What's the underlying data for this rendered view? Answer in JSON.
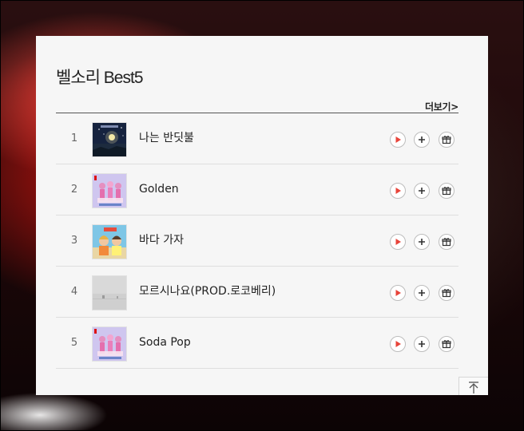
{
  "widget": {
    "title": "벨소리 Best5",
    "more_label": "더보기>"
  },
  "songs": [
    {
      "rank": "1",
      "title": "나는 반딧불",
      "art": "night-sky-firefly-art"
    },
    {
      "rank": "2",
      "title": "Golden",
      "art": "pink-anime-group-art"
    },
    {
      "rank": "3",
      "title": "바다 가자",
      "art": "beach-duo-art"
    },
    {
      "rank": "4",
      "title": "모르시나요(PROD.로코베리)",
      "art": "misty-grey-landscape-art"
    },
    {
      "rank": "5",
      "title": "Soda Pop",
      "art": "pink-anime-group-art"
    }
  ],
  "icons": {
    "play": "play-icon",
    "add": "plus-icon",
    "gift": "gift-icon",
    "top": "scroll-to-top-icon"
  },
  "colors": {
    "play_red": "#e8443a",
    "card_bg": "#f6f6f6"
  }
}
